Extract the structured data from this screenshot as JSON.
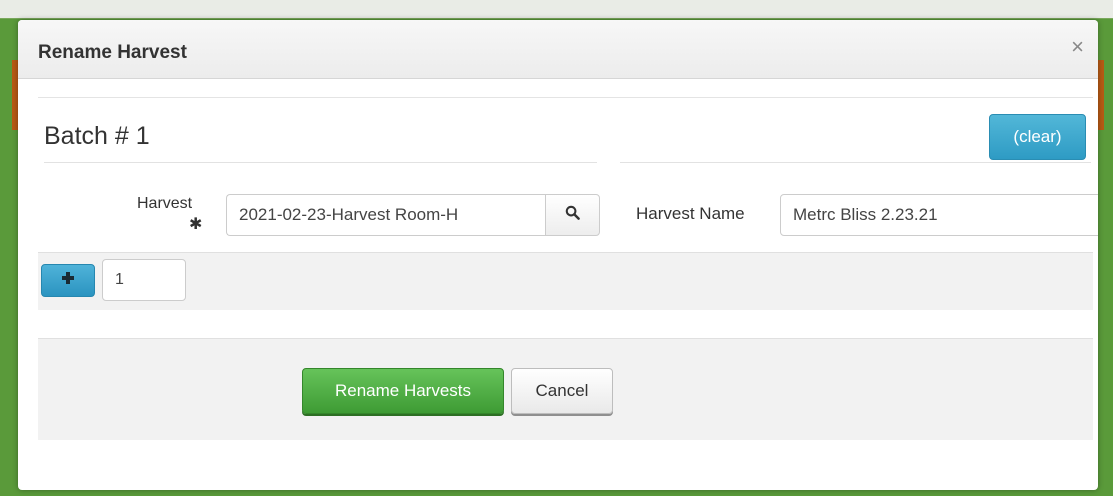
{
  "dialog": {
    "title": "Rename Harvest",
    "close_glyph": "×"
  },
  "batch": {
    "title": "Batch # 1",
    "clear_label": "(clear)"
  },
  "form": {
    "harvest_label": "Harvest",
    "required_glyph": "✱",
    "harvest_value": "2021-02-23-Harvest Room-H",
    "harvest_name_label": "Harvest Name",
    "harvest_name_value": "Metrc Bliss 2.23.21",
    "quantity_value": "1"
  },
  "footer": {
    "rename_label": "Rename Harvests",
    "cancel_label": "Cancel"
  },
  "icons": {
    "search": "search-icon",
    "plus": "plus-icon",
    "close": "close-icon",
    "required": "required-asterisk-icon"
  },
  "colors": {
    "primary_blue": "#2e9bc4",
    "success_green": "#3e9b34",
    "frame_green": "#5a9a3a"
  }
}
